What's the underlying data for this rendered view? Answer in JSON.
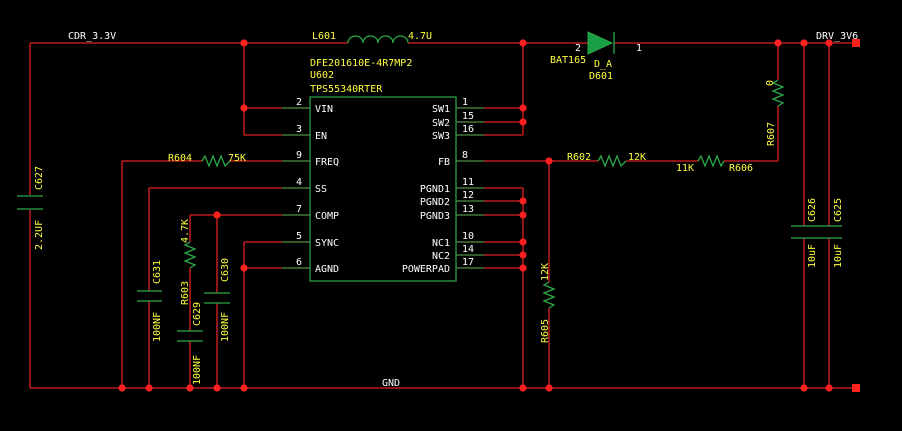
{
  "nets": {
    "input_rail": "CDR_3.3V",
    "output_rail": "DRV_3V6",
    "ground": "GND"
  },
  "ic": {
    "part_number": "DFE201610E-4R7MP2",
    "refdes": "U602",
    "value": "TPS55340RTER",
    "left_pins": [
      {
        "num": "2",
        "name": "VIN"
      },
      {
        "num": "3",
        "name": "EN"
      },
      {
        "num": "9",
        "name": "FREQ"
      },
      {
        "num": "4",
        "name": "SS"
      },
      {
        "num": "7",
        "name": "COMP"
      },
      {
        "num": "5",
        "name": "SYNC"
      },
      {
        "num": "6",
        "name": "AGND"
      }
    ],
    "right_pins": [
      {
        "num": "1",
        "name": "SW1"
      },
      {
        "num": "15",
        "name": "SW2"
      },
      {
        "num": "16",
        "name": "SW3"
      },
      {
        "num": "8",
        "name": "FB"
      },
      {
        "num": "11",
        "name": "PGND1"
      },
      {
        "num": "12",
        "name": "PGND2"
      },
      {
        "num": "13",
        "name": "PGND3"
      },
      {
        "num": "10",
        "name": "NC1"
      },
      {
        "num": "14",
        "name": "NC2"
      },
      {
        "num": "17",
        "name": "POWERPAD"
      }
    ]
  },
  "inductor": {
    "refdes": "L601",
    "value": "4.7U"
  },
  "diode": {
    "refdes": "D601",
    "value": "BAT165",
    "pin_anode": "2",
    "pin_cathode": "1",
    "part_suffix": "D_A"
  },
  "resistors": {
    "r604": {
      "refdes": "R604",
      "value": "75K"
    },
    "r603": {
      "refdes": "R603",
      "value": "4.7K"
    },
    "r602": {
      "refdes": "R602",
      "value": "12K"
    },
    "r606": {
      "refdes": "R606",
      "value": "11K"
    },
    "r607": {
      "refdes": "R607",
      "value": "0"
    },
    "r605": {
      "refdes": "R605",
      "value": "12K"
    }
  },
  "capacitors": {
    "c627": {
      "refdes": "C627",
      "value": "2.2UF"
    },
    "c631": {
      "refdes": "C631",
      "value": "100NF"
    },
    "c629": {
      "refdes": "C629",
      "value": "100NF"
    },
    "c630": {
      "refdes": "C630",
      "value": "100NF"
    },
    "c626": {
      "refdes": "C626",
      "value": "10uF"
    },
    "c625": {
      "refdes": "C625",
      "value": "10uF"
    }
  }
}
